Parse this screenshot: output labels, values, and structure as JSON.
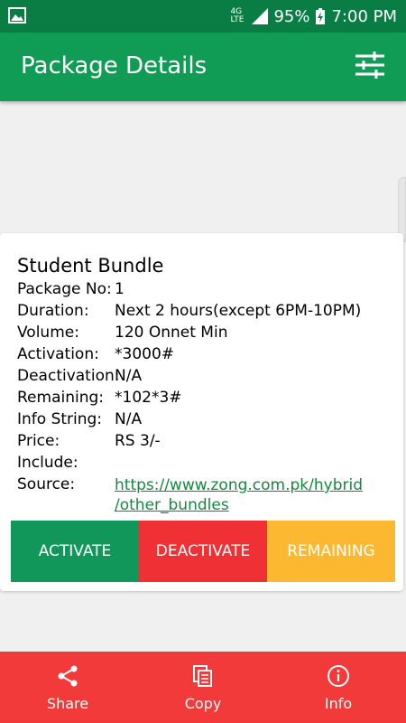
{
  "status_bar": {
    "network": "4G LTE",
    "battery": "95%",
    "time": "7:00 PM"
  },
  "app_bar": {
    "title": "Package Details",
    "filter_icon": "tune-icon"
  },
  "package": {
    "name": "Student Bundle",
    "fields": [
      {
        "label": "Package No:",
        "value": "1"
      },
      {
        "label": "Duration:",
        "value": "Next 2 hours(except 6PM-10PM)"
      },
      {
        "label": "Volume:",
        "value": "120 Onnet Min"
      },
      {
        "label": "Activation:",
        "value": "*3000#"
      },
      {
        "label": "Deactivation:",
        "value": "N/A"
      },
      {
        "label": "Remaining:",
        "value": "*102*3#"
      },
      {
        "label": "Info String:",
        "value": "N/A"
      },
      {
        "label": "Price:",
        "value": "RS 3/-"
      },
      {
        "label": "Include:",
        "value": ""
      }
    ],
    "source_label": "Source:",
    "source_line1": "https://www.zong.com.pk/hybrid",
    "source_line2": "/other_bundles"
  },
  "actions": {
    "activate": "ACTIVATE",
    "deactivate": "DEACTIVATE",
    "remaining": "REMAINING"
  },
  "bottom_nav": [
    {
      "label": "Share",
      "icon": "share-icon"
    },
    {
      "label": "Copy",
      "icon": "copy-icon"
    },
    {
      "label": "Info",
      "icon": "info-icon"
    }
  ],
  "colors": {
    "status_bar": "#0a7d44",
    "app_bar": "#119c56",
    "activate": "#12975a",
    "deactivate": "#ef3135",
    "remaining": "#fbb830",
    "bottom_bar": "#f23a3a",
    "link": "#118a3d"
  }
}
